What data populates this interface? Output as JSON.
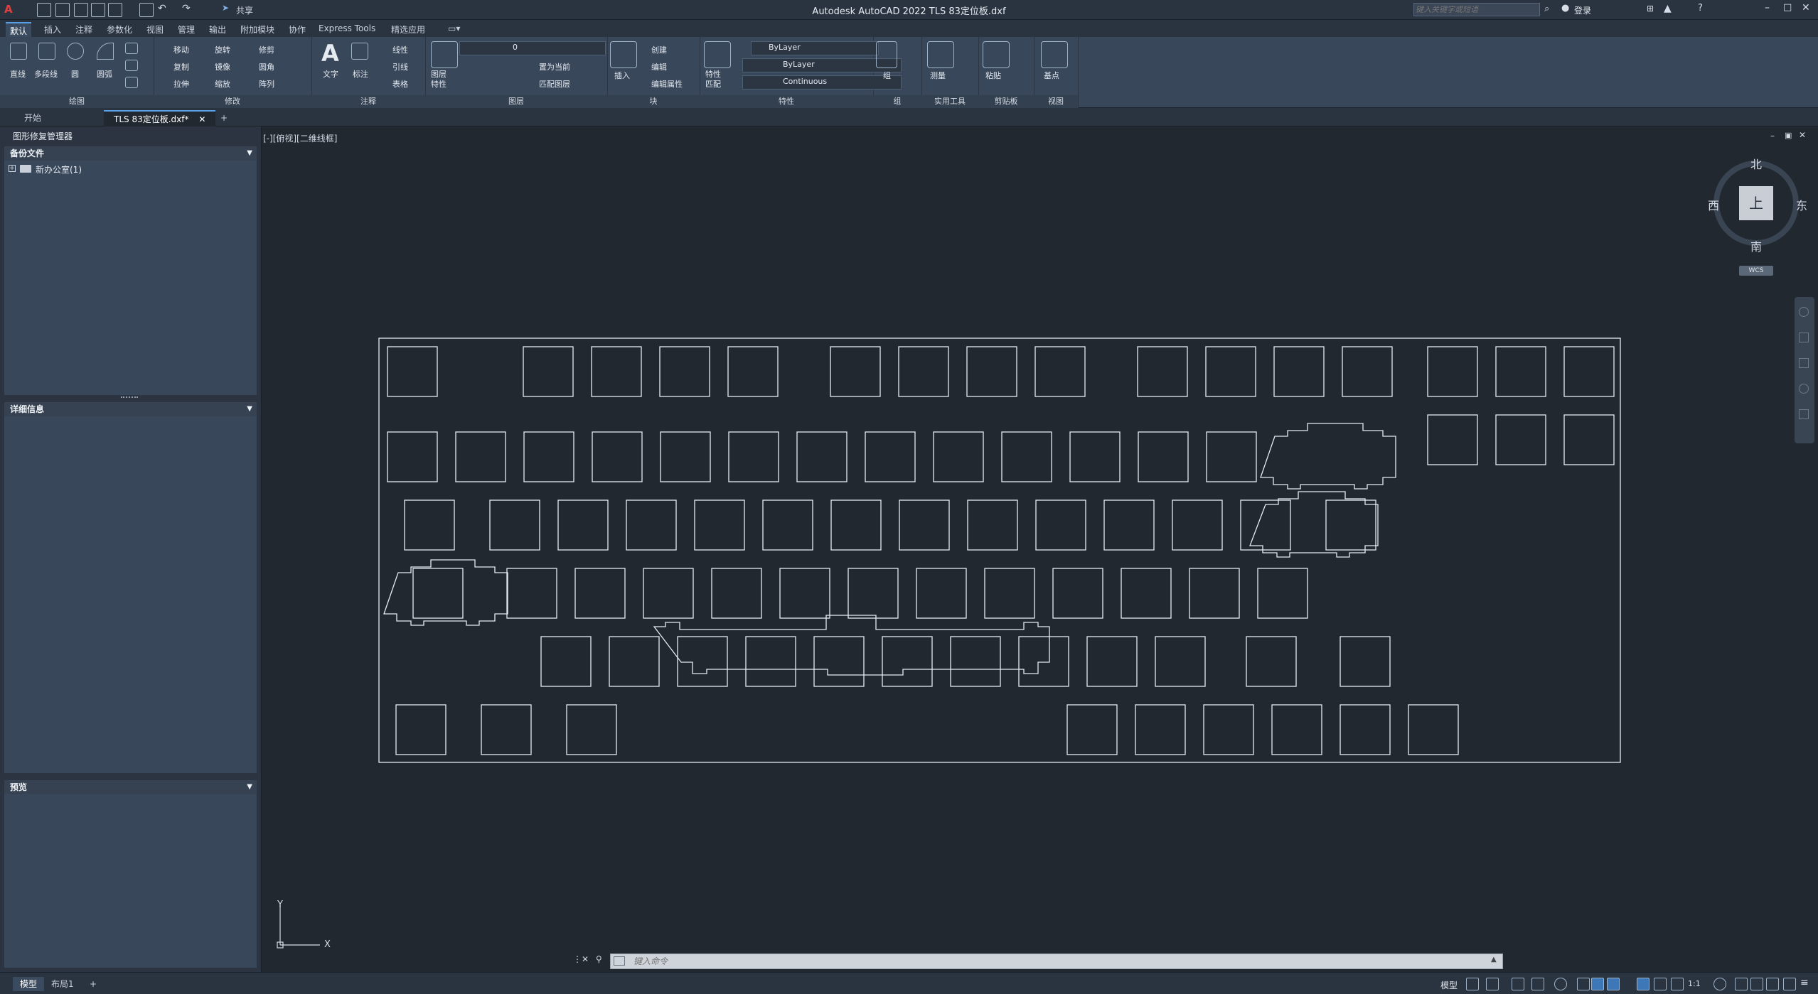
{
  "titlebar": {
    "title": "Autodesk AutoCAD 2022    TLS 83定位板.dxf",
    "app_menu": "A",
    "share_label": "共享",
    "search_placeholder": "键入关键字或短语",
    "login_label": "登录"
  },
  "ribbon_tabs": [
    "默认",
    "插入",
    "注释",
    "参数化",
    "视图",
    "管理",
    "输出",
    "附加模块",
    "协作",
    "Express Tools",
    "精选应用"
  ],
  "ribbon": {
    "draw": {
      "title": "绘图",
      "line": "直线",
      "polyline": "多段线",
      "circle": "圆",
      "arc": "圆弧"
    },
    "modify": {
      "title": "修改",
      "move": "移动",
      "rotate": "旋转",
      "trim": "修剪",
      "copy": "复制",
      "mirror": "镜像",
      "fillet": "圆角",
      "stretch": "拉伸",
      "scale": "缩放",
      "array": "阵列"
    },
    "annotation": {
      "title": "注释",
      "text": "文字",
      "dimension": "标注",
      "linear": "线性",
      "leader": "引线",
      "table": "表格"
    },
    "layers": {
      "title": "图层",
      "layer_props": "图层特性",
      "current_layer": "0",
      "set_current": "置为当前",
      "match_layer": "匹配图层"
    },
    "block": {
      "title": "块",
      "insert": "插入",
      "create": "创建",
      "edit": "编辑",
      "edit_attr": "编辑属性"
    },
    "properties": {
      "title": "特性",
      "match": "特性匹配",
      "color": "ByLayer",
      "lineweight": "ByLayer",
      "linetype": "Continuous"
    },
    "groups": {
      "title": "组",
      "group": "组"
    },
    "utilities": {
      "title": "实用工具",
      "measure": "测量"
    },
    "clipboard": {
      "title": "剪贴板",
      "paste": "粘贴"
    },
    "view": {
      "title": "视图",
      "base": "基点"
    }
  },
  "doc_tabs": {
    "start": "开始",
    "active": "TLS 83定位板.dxf*"
  },
  "palette": {
    "title": "图形修复管理器",
    "backup_header": "备份文件",
    "tree_item": "新办公室(1)",
    "details_header": "详细信息",
    "preview_header": "预览"
  },
  "viewport": {
    "label": "[-][俯视][二维线框]"
  },
  "viewcube": {
    "north": "北",
    "south": "南",
    "east": "东",
    "west": "西",
    "top": "上",
    "wcs": "WCS"
  },
  "ucs": {
    "x": "X",
    "y": "Y"
  },
  "command": {
    "placeholder": "键入命令"
  },
  "status": {
    "model_tab": "模型",
    "layout_tab": "布局1",
    "mode": "模型",
    "scale": "1:1"
  }
}
